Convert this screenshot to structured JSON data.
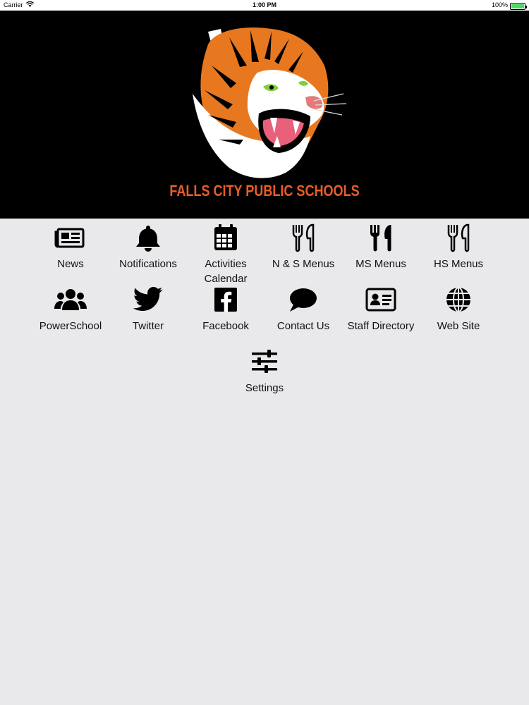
{
  "status_bar": {
    "carrier": "Carrier",
    "time": "1:00 PM",
    "battery": "100%",
    "battery_level": 1.0
  },
  "header": {
    "logo_text": "FALLS CITY PUBLIC SCHOOLS",
    "accent_color": "#e85d27",
    "background_color": "#000000"
  },
  "tiles": [
    {
      "label": "News",
      "icon": "newspaper-icon"
    },
    {
      "label": "Notifications",
      "icon": "bell-icon"
    },
    {
      "label": "Activities\nCalendar",
      "icon": "calendar-icon"
    },
    {
      "label": "N & S Menus",
      "icon": "utensils-outline-icon"
    },
    {
      "label": "MS Menus",
      "icon": "utensils-icon"
    },
    {
      "label": "HS Menus",
      "icon": "utensils-outline-icon"
    },
    {
      "label": "PowerSchool",
      "icon": "users-icon"
    },
    {
      "label": "Twitter",
      "icon": "twitter-icon"
    },
    {
      "label": "Facebook",
      "icon": "facebook-icon"
    },
    {
      "label": "Contact Us",
      "icon": "speech-bubble-icon"
    },
    {
      "label": "Staff Directory",
      "icon": "id-card-icon"
    },
    {
      "label": "Web Site",
      "icon": "globe-icon"
    },
    {
      "label": "Settings",
      "icon": "sliders-icon"
    }
  ]
}
